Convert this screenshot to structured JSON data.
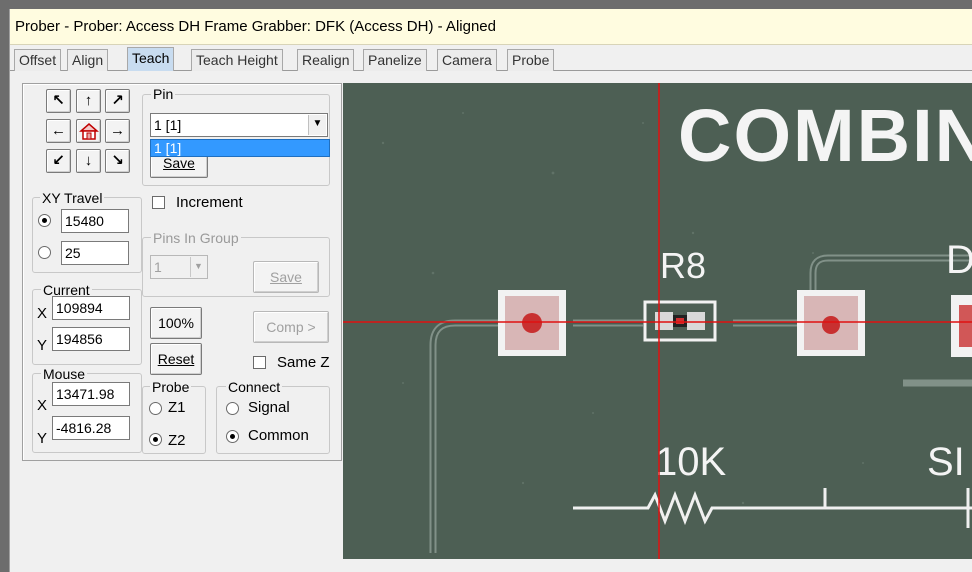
{
  "window": {
    "title": "Prober - Prober: Access DH Frame Grabber: DFK (Access DH) - Aligned"
  },
  "tabs": [
    {
      "label": "Offset"
    },
    {
      "label": "Align"
    },
    {
      "label": "Teach"
    },
    {
      "label": "Teach Height"
    },
    {
      "label": "Realign"
    },
    {
      "label": "Panelize"
    },
    {
      "label": "Camera"
    },
    {
      "label": "Probe"
    }
  ],
  "active_tab": "Teach",
  "jog": {
    "arrows": [
      "↖",
      "↑",
      "↗",
      "←",
      "home",
      "→",
      "↙",
      "↓",
      "↘"
    ]
  },
  "pin": {
    "group_label": "Pin",
    "selected": "1 [1]",
    "dropdown_option": "1 [1]",
    "save_label": "Save",
    "increment_label": "Increment"
  },
  "xy_travel": {
    "group_label": "XY Travel",
    "value1": "15480",
    "value2": "25"
  },
  "pins_in_group": {
    "group_label": "Pins In Group",
    "selected": "1",
    "save_label": "Save"
  },
  "current": {
    "group_label": "Current",
    "x_label": "X",
    "x": "109894",
    "y_label": "Y",
    "y": "194856"
  },
  "buttons": {
    "zoom": "100%",
    "reset": "Reset",
    "comp": "Comp >"
  },
  "same_z_label": "Same Z",
  "mouse": {
    "group_label": "Mouse",
    "x_label": "X",
    "x": "13471.98",
    "y_label": "Y",
    "y": "-4816.28"
  },
  "probe": {
    "group_label": "Probe",
    "z1": "Z1",
    "z2": "Z2",
    "selected": "Z2"
  },
  "connect": {
    "group_label": "Connect",
    "signal": "Signal",
    "common": "Common",
    "selected": "Common"
  },
  "camera": {
    "silkscreen_title": "COMBINA",
    "ref_r8": "R8",
    "ref_d": "D",
    "value_10k": "10K",
    "ref_sig": "SI"
  },
  "colors": {
    "crosshair": "#e01010",
    "board": "#4b5d52",
    "titlebar": "#fffce0",
    "active_tab": "#c8dcf0"
  }
}
